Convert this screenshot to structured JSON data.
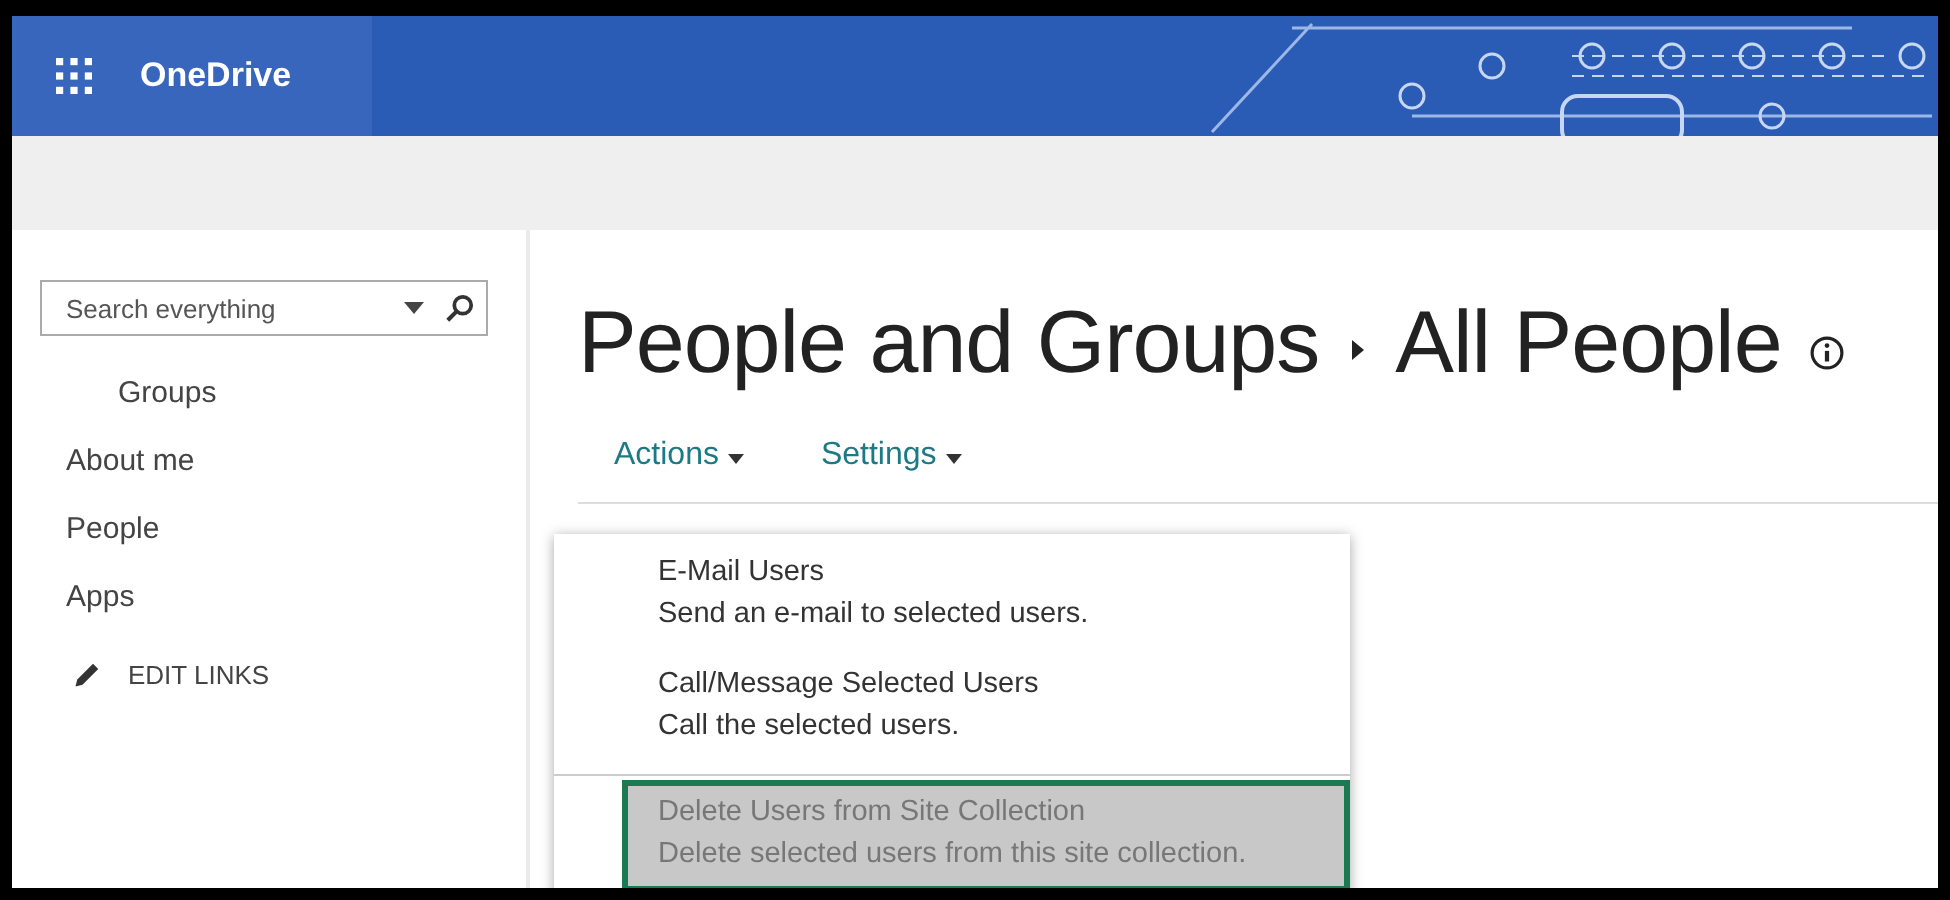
{
  "app_bar": {
    "title": "OneDrive"
  },
  "sidebar": {
    "search": {
      "placeholder": "Search everything"
    },
    "items": [
      {
        "label": "Groups",
        "indented": true
      },
      {
        "label": "About me",
        "indented": false
      },
      {
        "label": "People",
        "indented": false
      },
      {
        "label": "Apps",
        "indented": false
      }
    ],
    "edit_links": "EDIT LINKS"
  },
  "page": {
    "breadcrumb": [
      "People and Groups",
      "All People"
    ],
    "toolbar": [
      "Actions",
      "Settings"
    ],
    "menu": {
      "sections": [
        {
          "items": [
            {
              "title": "E-Mail Users",
              "description": "Send an e-mail to selected users.",
              "selected": false
            },
            {
              "title": "Call/Message Selected Users",
              "description": "Call the selected users.",
              "selected": false
            }
          ]
        },
        {
          "items": [
            {
              "title": "Delete Users from Site Collection",
              "description": "Delete selected users from this site collection.",
              "selected": true
            }
          ]
        }
      ]
    }
  }
}
